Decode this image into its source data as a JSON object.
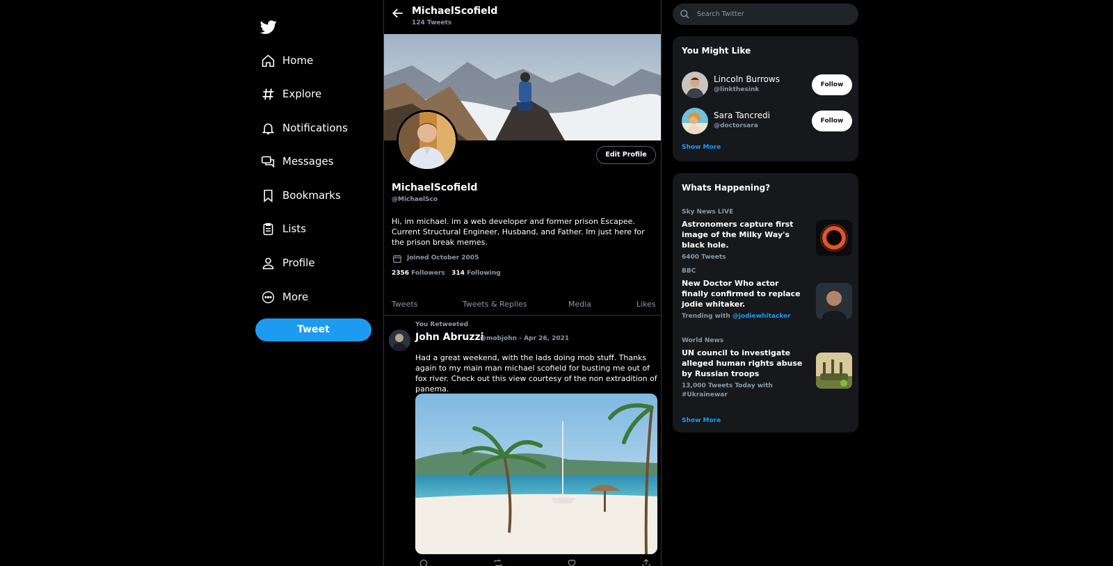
{
  "sidebar": {
    "logo_icon": "twitter-bird-icon",
    "items": [
      {
        "label": "Home",
        "icon": "home-icon"
      },
      {
        "label": "Explore",
        "icon": "hashtag-icon"
      },
      {
        "label": "Notifications",
        "icon": "bell-icon"
      },
      {
        "label": "Messages",
        "icon": "messages-icon"
      },
      {
        "label": "Bookmarks",
        "icon": "bookmark-icon"
      },
      {
        "label": "Lists",
        "icon": "list-icon"
      },
      {
        "label": "Profile",
        "icon": "person-icon"
      },
      {
        "label": "More",
        "icon": "more-circle-icon"
      }
    ],
    "tweet_button": "Tweet"
  },
  "header": {
    "name": "MichaelScofield",
    "tweet_count": "124 Tweets"
  },
  "profile": {
    "edit_button": "Edit Profile",
    "name": "MichaelScofield",
    "handle": "@MichaelSco",
    "bio": "Hi, im michael. im a web developer and former prison Escapee. Current Structural Engineer, Husband, and Father. Im just here for the prison break memes.",
    "joined": "Joined October 2005",
    "followers_count": "2356",
    "followers_label": "Followers",
    "following_count": "314",
    "following_label": "Following"
  },
  "tabs": [
    "Tweets",
    "Tweets & Replies",
    "Media",
    "Likes"
  ],
  "tweet": {
    "retweet_note": "You Retweeted",
    "author": "John Abruzzi",
    "meta": "@mobjohn - Apr 26, 2021",
    "text": "Had a great weekend, with the lads doing mob stuff. Thanks again to my main man michael scofield for busting me out of fox river. Check out this view courtesy of the non extradition of panema."
  },
  "search": {
    "placeholder": "Search Twitter"
  },
  "you_might_like": {
    "title": "You Might Like",
    "users": [
      {
        "name": "Lincoln Burrows",
        "handle": "@linkthesink",
        "button": "Follow"
      },
      {
        "name": "Sara Tancredi",
        "handle": "@doctorsara",
        "button": "Follow"
      }
    ],
    "show_more": "Show More"
  },
  "whats_happening": {
    "title": "Whats Happening?",
    "trends": [
      {
        "source": "Sky News LIVE",
        "headline": "Astronomers capture first image of the Milky Way's black hole.",
        "footer": "6400 Tweets"
      },
      {
        "source": "BBC",
        "headline": "New Doctor Who actor finally confirmed to replace jodie whitaker.",
        "footer_prefix": "Trending with ",
        "footer_link": "@jodiewhitacker"
      },
      {
        "source": "World News",
        "headline": "UN council to investigate alleged human rights abuse by Russian troops",
        "footer": "13,000 Tweets Today with #Ukrainewar"
      }
    ],
    "show_more": "Show More"
  },
  "colors": {
    "accent": "#1d9bf0",
    "background": "#000000",
    "card": "#16181c",
    "muted_text": "#8b98a5"
  }
}
